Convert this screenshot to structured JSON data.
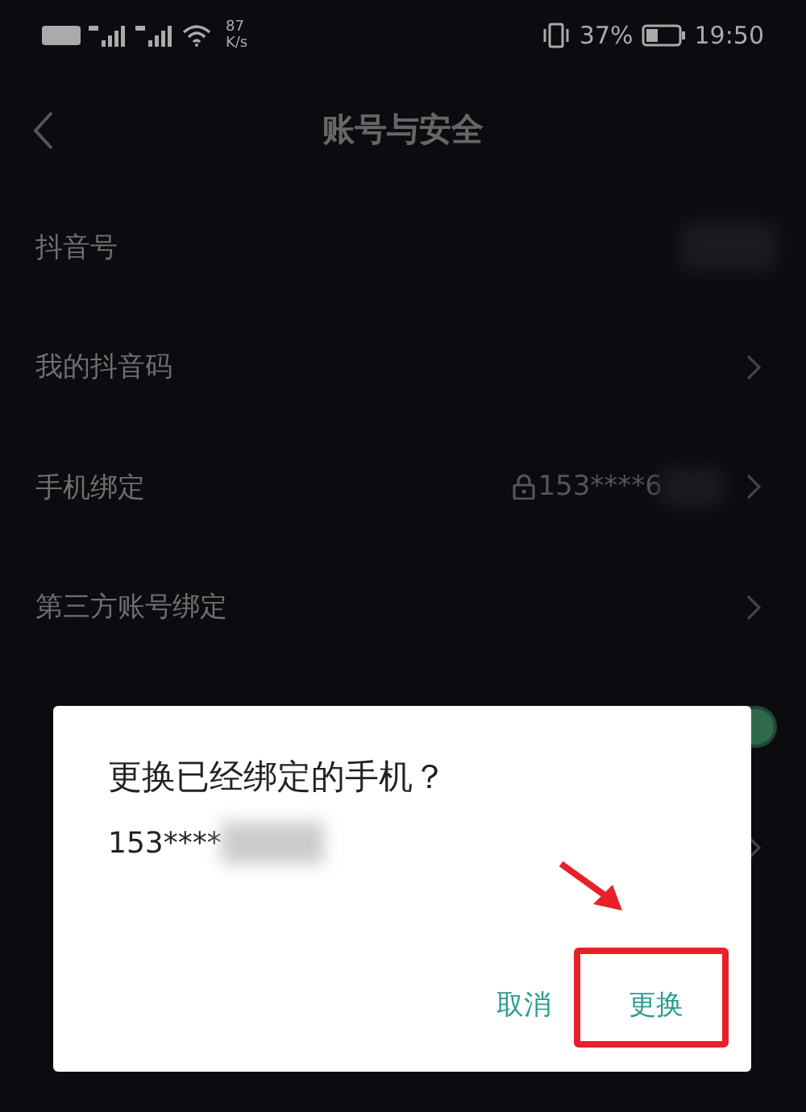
{
  "status_bar": {
    "speed": "87",
    "speed_unit": "K/s",
    "battery": "37%",
    "time": "19:50"
  },
  "nav": {
    "title": "账号与安全"
  },
  "rows": [
    {
      "label": "抖音号",
      "kind": "redacted"
    },
    {
      "label": "我的抖音码",
      "kind": "chevron"
    },
    {
      "label": "手机绑定",
      "kind": "phone",
      "value": "153****6"
    },
    {
      "label": "第三方账号绑定",
      "kind": "chevron"
    },
    {
      "kind": "toggle",
      "on": true
    },
    {
      "kind": "chevron"
    }
  ],
  "dialog": {
    "title": "更换已经绑定的手机？",
    "message": "153****",
    "buttons": [
      {
        "label": "取消"
      },
      {
        "label": "更换"
      }
    ]
  },
  "annotations": {
    "arrow": true,
    "highlight_box": true
  }
}
